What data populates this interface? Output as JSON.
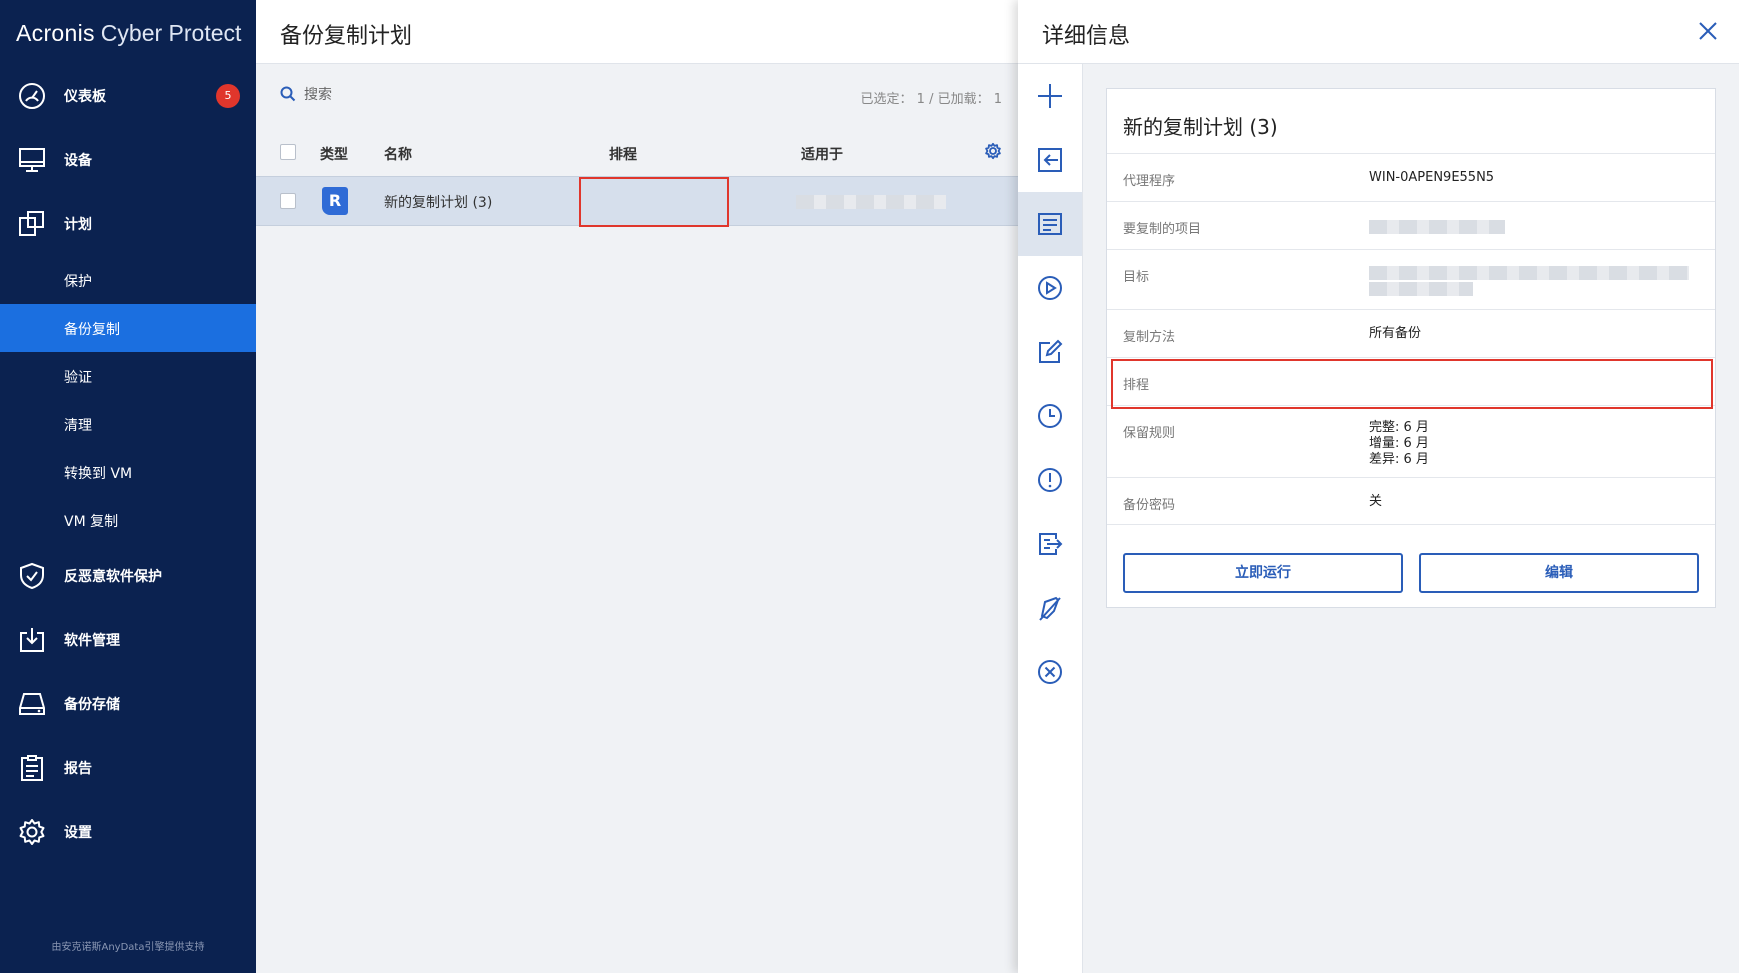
{
  "brand": {
    "name": "Acronis",
    "product": "Cyber Protect"
  },
  "sidebar": {
    "items": [
      {
        "label": "仪表板",
        "badge": "5"
      },
      {
        "label": "设备"
      },
      {
        "label": "计划"
      },
      {
        "label": "反恶意软件保护"
      },
      {
        "label": "软件管理"
      },
      {
        "label": "备份存储"
      },
      {
        "label": "报告"
      },
      {
        "label": "设置"
      }
    ],
    "subitems": [
      "保护",
      "备份复制",
      "验证",
      "清理",
      "转换到 VM",
      "VM 复制"
    ],
    "active_subitem": "备份复制",
    "footer": "由安克诺斯AnyData引擎提供支持"
  },
  "main": {
    "title": "备份复制计划",
    "search_placeholder": "搜索",
    "counts": "已选定： 1 / 已加载： 1",
    "columns": [
      "类型",
      "名称",
      "排程",
      "适用于"
    ],
    "rows": [
      {
        "type_icon": "R",
        "name": "新的复制计划 (3)",
        "schedule": ""
      }
    ]
  },
  "detail": {
    "title": "详细信息",
    "card_title": "新的复制计划 (3)",
    "fields": [
      {
        "key": "代理程序",
        "value": "WIN-0APEN9E55N5"
      },
      {
        "key": "要复制的项目",
        "value": ""
      },
      {
        "key": "目标",
        "value": ""
      },
      {
        "key": "复制方法",
        "value": "所有备份"
      },
      {
        "key": "排程",
        "value": ""
      },
      {
        "key": "保留规则",
        "lines": [
          "完整: 6 月",
          "增量: 6 月",
          "差异: 6 月"
        ]
      },
      {
        "key": "备份密码",
        "value": "关"
      }
    ],
    "buttons": {
      "run_now": "立即运行",
      "edit": "编辑"
    }
  },
  "colors": {
    "sidebar_bg": "#0b2250",
    "accent": "#1b6fe0",
    "badge": "#e0362c",
    "highlight": "#e0362c"
  }
}
